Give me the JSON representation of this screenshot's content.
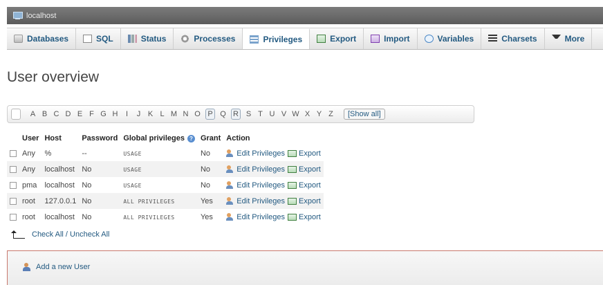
{
  "titlebar": {
    "server": "localhost",
    "icon": "server-icon"
  },
  "tabs": [
    {
      "label": "Databases",
      "icon": "databases-icon"
    },
    {
      "label": "SQL",
      "icon": "sql-icon"
    },
    {
      "label": "Status",
      "icon": "status-icon"
    },
    {
      "label": "Processes",
      "icon": "processes-icon"
    },
    {
      "label": "Privileges",
      "icon": "privileges-icon",
      "active": true
    },
    {
      "label": "Export",
      "icon": "export-icon"
    },
    {
      "label": "Import",
      "icon": "import-icon"
    },
    {
      "label": "Variables",
      "icon": "variables-icon"
    },
    {
      "label": "Charsets",
      "icon": "charsets-icon"
    },
    {
      "label": "More",
      "icon": "dropdown-icon"
    }
  ],
  "page_title": "User overview",
  "alphabet": {
    "letters": [
      "A",
      "B",
      "C",
      "D",
      "E",
      "F",
      "G",
      "H",
      "I",
      "J",
      "K",
      "L",
      "M",
      "N",
      "O",
      "P",
      "Q",
      "R",
      "S",
      "T",
      "U",
      "V",
      "W",
      "X",
      "Y",
      "Z"
    ],
    "active": [
      "P",
      "R"
    ],
    "show_all": "[Show all]"
  },
  "table": {
    "headers": {
      "user": "User",
      "host": "Host",
      "password": "Password",
      "global_privileges": "Global privileges",
      "grant": "Grant",
      "action": "Action"
    },
    "rows": [
      {
        "user": "Any",
        "host": "%",
        "password": "--",
        "privileges": "USAGE",
        "grant": "No",
        "edit": "Edit Privileges",
        "export": "Export"
      },
      {
        "user": "Any",
        "host": "localhost",
        "password": "No",
        "privileges": "USAGE",
        "grant": "No",
        "edit": "Edit Privileges",
        "export": "Export"
      },
      {
        "user": "pma",
        "host": "localhost",
        "password": "No",
        "privileges": "USAGE",
        "grant": "No",
        "edit": "Edit Privileges",
        "export": "Export"
      },
      {
        "user": "root",
        "host": "127.0.0.1",
        "password": "No",
        "privileges": "ALL PRIVILEGES",
        "grant": "Yes",
        "edit": "Edit Privileges",
        "export": "Export"
      },
      {
        "user": "root",
        "host": "localhost",
        "password": "No",
        "privileges": "ALL PRIVILEGES",
        "grant": "Yes",
        "edit": "Edit Privileges",
        "export": "Export"
      }
    ]
  },
  "check_all_label": "Check All / Uncheck All",
  "add_user_label": "Add a new User",
  "colors": {
    "accent": "#235a81",
    "warning": "#cc0000",
    "titlebar": "#6a6a6a"
  }
}
